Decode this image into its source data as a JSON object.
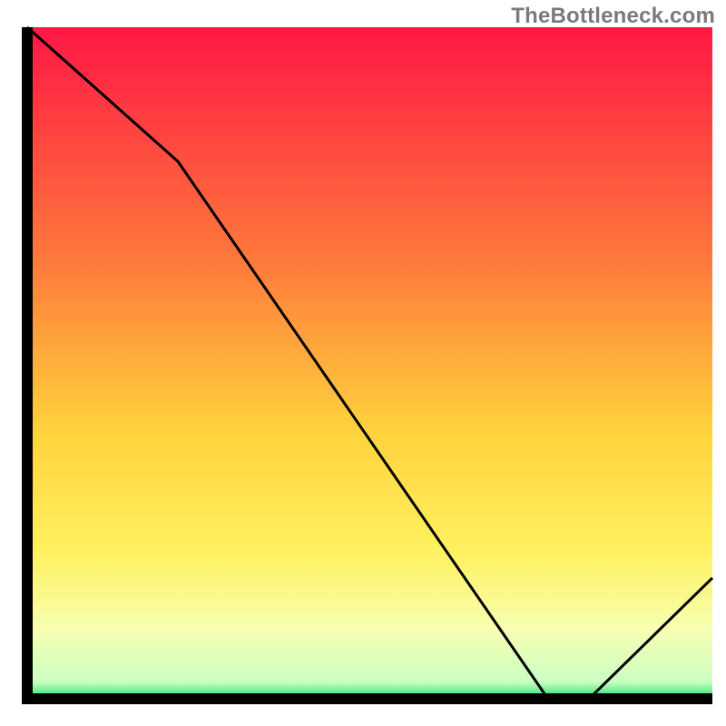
{
  "watermark": {
    "text": "TheBottleneck.com"
  },
  "chart_data": {
    "type": "line",
    "title": "",
    "xlabel": "",
    "ylabel": "",
    "xlim": [
      0,
      100
    ],
    "ylim": [
      0,
      100
    ],
    "x": [
      0,
      22,
      76,
      82,
      100
    ],
    "values": [
      100,
      80,
      0,
      0,
      18
    ],
    "marker": {
      "x_start": 76,
      "x_end": 82,
      "y": 0,
      "color": "#e06a6a"
    },
    "gradient_stops": [
      {
        "offset": 0.0,
        "color": "#ff1744"
      },
      {
        "offset": 0.35,
        "color": "#ff7a3c"
      },
      {
        "offset": 0.6,
        "color": "#ffd23c"
      },
      {
        "offset": 0.78,
        "color": "#fff160"
      },
      {
        "offset": 0.9,
        "color": "#f7ffb3"
      },
      {
        "offset": 0.975,
        "color": "#caffc2"
      },
      {
        "offset": 1.0,
        "color": "#1ee06a"
      }
    ],
    "axis_color": "#000000",
    "line_color": "#000000"
  }
}
